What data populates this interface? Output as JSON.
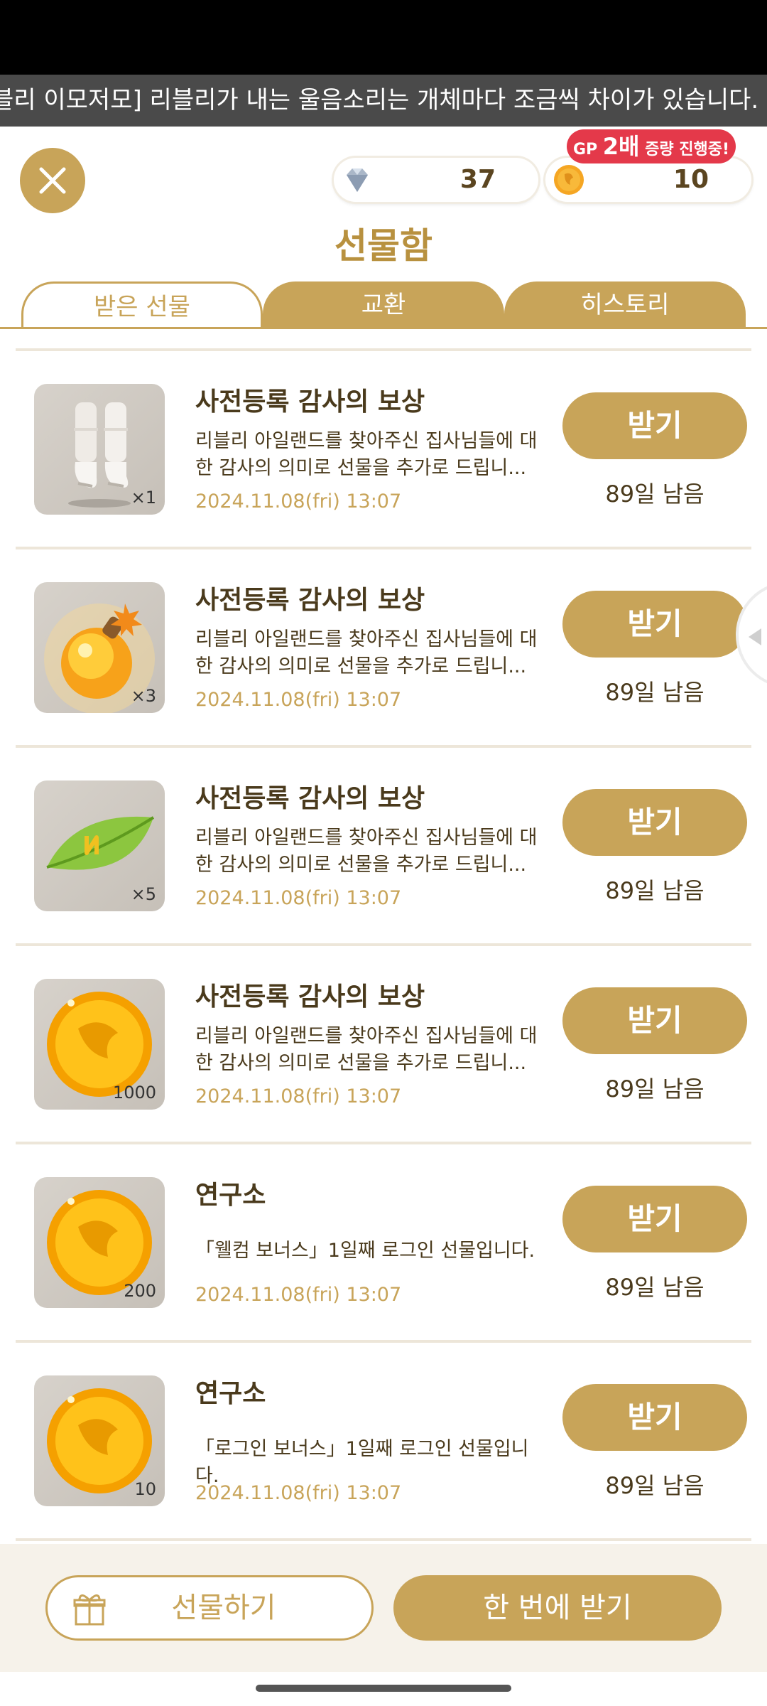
{
  "ticker": {
    "text": "블리 이모저모] 리블리가 내는 울음소리는 개체마다 조금씩 차이가 있습니다."
  },
  "header": {
    "gem_value": "37",
    "coin_value": "10",
    "promo": {
      "prefix": "GP ",
      "bold": "2배",
      "suffix": " 증량 진행중!"
    },
    "title": "선물함"
  },
  "tabs": [
    {
      "label": "받은 선물",
      "active": true
    },
    {
      "label": "교환",
      "active": false
    },
    {
      "label": "히스토리",
      "active": false
    }
  ],
  "items": [
    {
      "title": "사전등록 감사의 보상",
      "desc": "리블리 아일랜드를 찾아주신 집사님들에 대한 감사의 의미로 선물을 추가로 드립니...",
      "date": "2024.11.08(fri) 13:07",
      "qty": "×1",
      "icon": "boots-icon",
      "button": "받기",
      "remaining": "89일 남음"
    },
    {
      "title": "사전등록 감사의 보상",
      "desc": "리블리 아일랜드를 찾아주신 집사님들에 대한 감사의 의미로 선물을 추가로 드립니...",
      "date": "2024.11.08(fri) 13:07",
      "qty": "×3",
      "icon": "potion-bomb-icon",
      "button": "받기",
      "remaining": "89일 남음"
    },
    {
      "title": "사전등록 감사의 보상",
      "desc": "리블리 아일랜드를 찾아주신 집사님들에 대한 감사의 의미로 선물을 추가로 드립니...",
      "date": "2024.11.08(fri) 13:07",
      "qty": "×5",
      "icon": "normal-leaf-icon",
      "button": "받기",
      "remaining": "89일 남음"
    },
    {
      "title": "사전등록 감사의 보상",
      "desc": "리블리 아일랜드를 찾아주신 집사님들에 대한 감사의 의미로 선물을 추가로 드립니...",
      "date": "2024.11.08(fri) 13:07",
      "qty": "1000",
      "icon": "gold-coin-icon",
      "button": "받기",
      "remaining": "89일 남음"
    },
    {
      "title": "연구소",
      "desc": "「웰컴 보너스」1일째 로그인 선물입니다.",
      "date": "2024.11.08(fri) 13:07",
      "qty": "200",
      "icon": "gold-coin-icon",
      "button": "받기",
      "remaining": "89일 남음"
    },
    {
      "title": "연구소",
      "desc": "「로그인 보너스」1일째 로그인 선물입니다.",
      "date": "2024.11.08(fri) 13:07",
      "qty": "10",
      "icon": "gold-coin-icon",
      "button": "받기",
      "remaining": "89일 남음"
    }
  ],
  "footer": {
    "gift_label": "선물하기",
    "receive_all_label": "한 번에 받기"
  },
  "colors": {
    "accent": "#c8a459",
    "text": "#4a3a1c",
    "badge": "#e4394a"
  }
}
